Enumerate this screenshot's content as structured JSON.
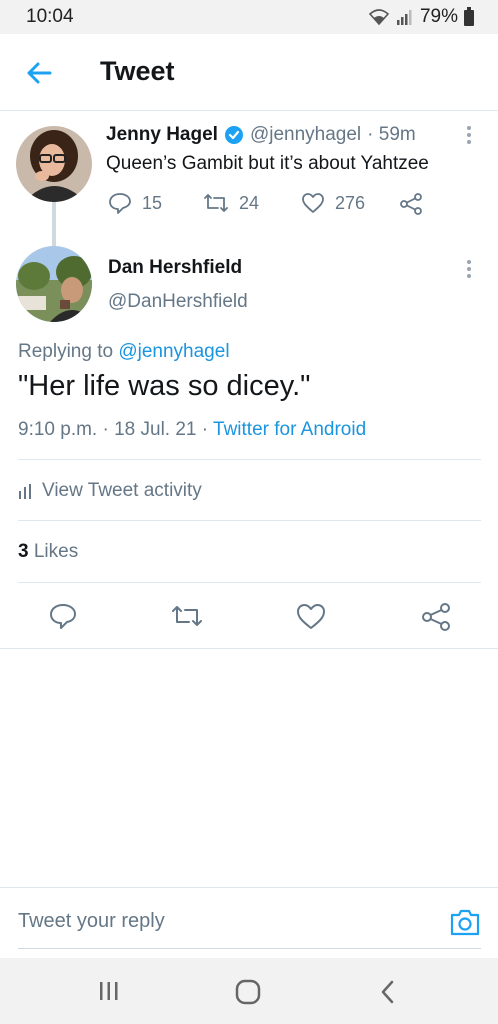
{
  "status_bar": {
    "time": "10:04",
    "battery": "79%"
  },
  "header": {
    "title": "Tweet"
  },
  "parent_tweet": {
    "author_name": "Jenny Hagel",
    "handle": "@jennyhagel",
    "time_ago": "· 59m",
    "text": "Queen’s Gambit but it’s about Yahtzee",
    "replies": "15",
    "retweets": "24",
    "likes": "276"
  },
  "main_tweet": {
    "author_name": "Dan Hershfield",
    "handle": "@DanHershfield",
    "replying_prefix": "Replying to ",
    "replying_to": "@jennyhagel",
    "text": "\"Her life was so dicey.\"",
    "timestamp": "9:10 p.m. · 18 Jul. 21 · ",
    "source": "Twitter for Android",
    "activity_label": "View Tweet activity",
    "likes_count": "3",
    "likes_label": "Likes"
  },
  "reply_bar": {
    "placeholder": "Tweet your reply"
  },
  "colors": {
    "accent": "#1da1f2",
    "text": "#14171a",
    "secondary": "#657786"
  }
}
